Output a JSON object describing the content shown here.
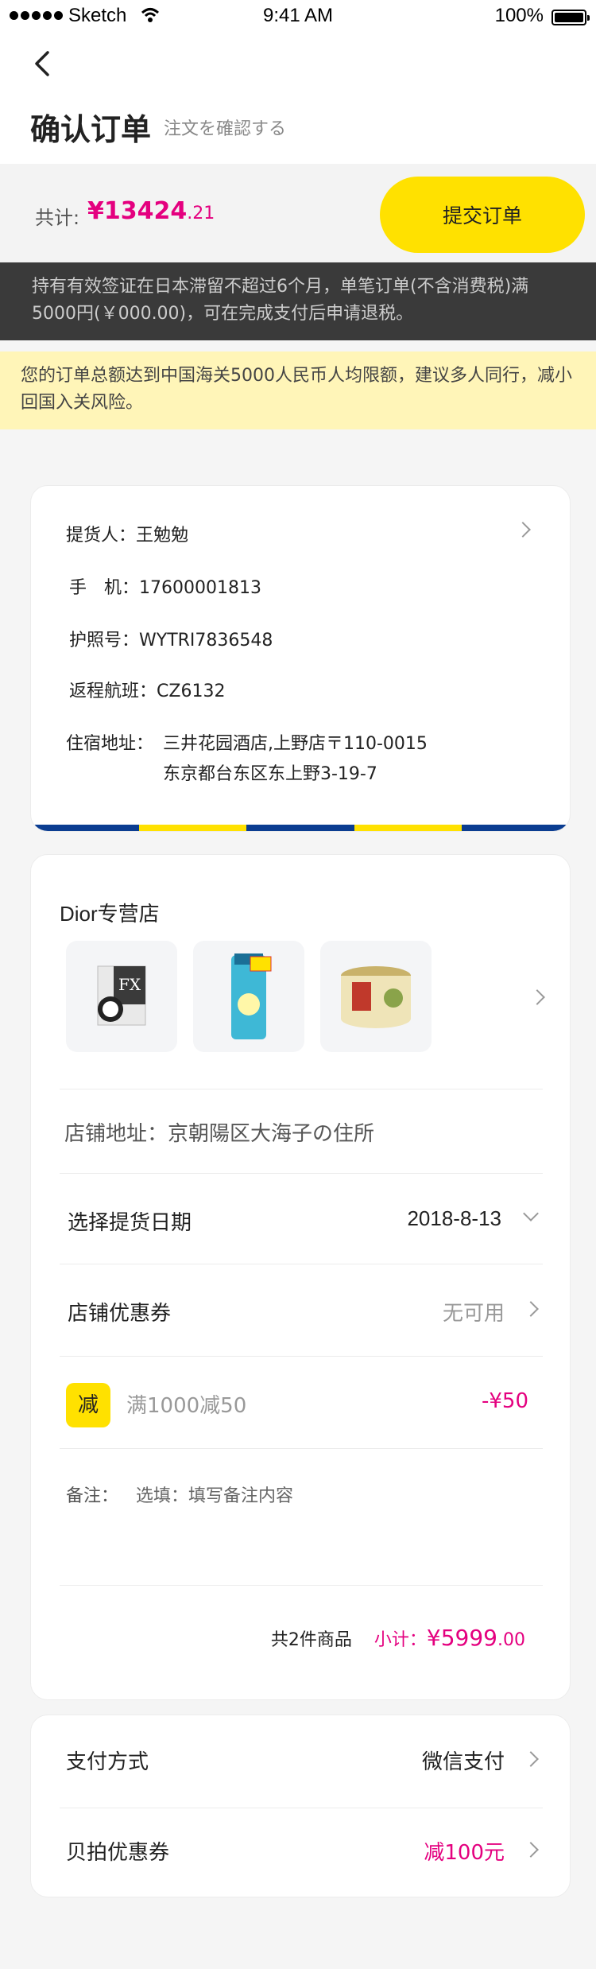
{
  "status_bar": {
    "carrier": "Sketch",
    "time": "9:41 AM",
    "battery": "100%"
  },
  "header": {
    "title": "确认订单",
    "subtitle": "注文を確認する"
  },
  "total": {
    "label": "共计:",
    "currency": "¥",
    "amount_int": "13424",
    "amount_dec": ".21",
    "submit_label": "提交订单"
  },
  "notices": {
    "dark": "持有有效签证在日本滞留不超过6个月，单笔订单(不含消费税)满5000円(￥000.00)，可在完成支付后申请退税。",
    "yellow": "您的订单总额达到中国海关5000人民币人均限额，建议多人同行，减小回国入关风险。"
  },
  "pickup": {
    "picker_label": "提货人：",
    "picker_value": "王勉勉",
    "phone_label": "手　机：",
    "phone_value": "17600001813",
    "passport_label": "护照号：",
    "passport_value": "WYTRI7836548",
    "flight_label": "返程航班：",
    "flight_value": "CZ6132",
    "address_label": "住宿地址：",
    "address_line1": "三井花园酒店,上野店〒110-0015",
    "address_line2": "东京都台东区东上野3-19-7",
    "stripe_colors": [
      "#0b3d91",
      "#ffe100",
      "#0b3d91",
      "#ffe100",
      "#0b3d91"
    ]
  },
  "store": {
    "name": "Dior专营店",
    "products": [
      {
        "icon": "eye-drops-box-icon"
      },
      {
        "icon": "sunscreen-tube-icon"
      },
      {
        "icon": "cream-jar-icon"
      }
    ],
    "address": "店铺地址：京朝陽区大海子の住所",
    "pickup_date_label": "选择提货日期",
    "pickup_date_value": "2018-8-13",
    "coupon_label": "店铺优惠券",
    "coupon_value": "无可用",
    "discount_badge": "减",
    "discount_text": "满1000减50",
    "discount_amount": "-¥50",
    "note_label": "备注：",
    "note_placeholder": "选填：填写备注内容",
    "count_text": "共2件商品",
    "subtotal_label": "小计：",
    "subtotal_int": "¥5999",
    "subtotal_dec": ".00"
  },
  "payment": {
    "method_label": "支付方式",
    "method_value": "微信支付",
    "coupon_label": "贝拍优惠券",
    "coupon_value": "减100元"
  },
  "colors": {
    "accent": "#e4007f",
    "brand_yellow": "#ffe100",
    "dark_notice": "#3a3a3a"
  }
}
